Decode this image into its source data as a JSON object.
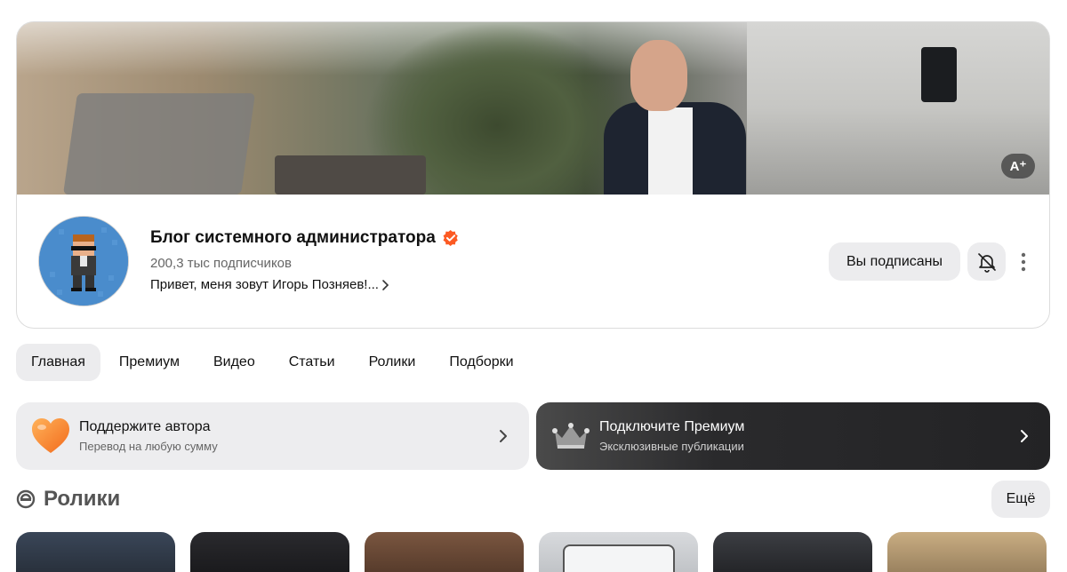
{
  "banner": {
    "ai_badge": "A⁺"
  },
  "channel": {
    "name": "Блог системного администратора",
    "subscribers": "200,3 тыс подписчиков",
    "description": "Привет, меня зовут Игорь Позняев!...",
    "subscribed_label": "Вы подписаны",
    "verified_color": "#fc5a23"
  },
  "tabs": [
    {
      "label": "Главная",
      "active": true
    },
    {
      "label": "Премиум",
      "active": false
    },
    {
      "label": "Видео",
      "active": false
    },
    {
      "label": "Статьи",
      "active": false
    },
    {
      "label": "Ролики",
      "active": false
    },
    {
      "label": "Подборки",
      "active": false
    }
  ],
  "promos": {
    "support": {
      "title": "Поддержите автора",
      "subtitle": "Перевод на любую сумму",
      "icon": "heart-icon"
    },
    "premium": {
      "title": "Подключите Премиум",
      "subtitle": "Эксклюзивные публикации",
      "icon": "crown-icon"
    }
  },
  "shorts_section": {
    "title": "Ролики",
    "more_label": "Ещё",
    "icon": "shorts-icon"
  },
  "shorts": [
    {
      "color": "#2c3440"
    },
    {
      "color": "#1f1f22"
    },
    {
      "color": "#6b4a37"
    },
    {
      "color": "#cfd2d6"
    },
    {
      "color": "#2a2c30"
    },
    {
      "color": "#b8a07a"
    }
  ]
}
